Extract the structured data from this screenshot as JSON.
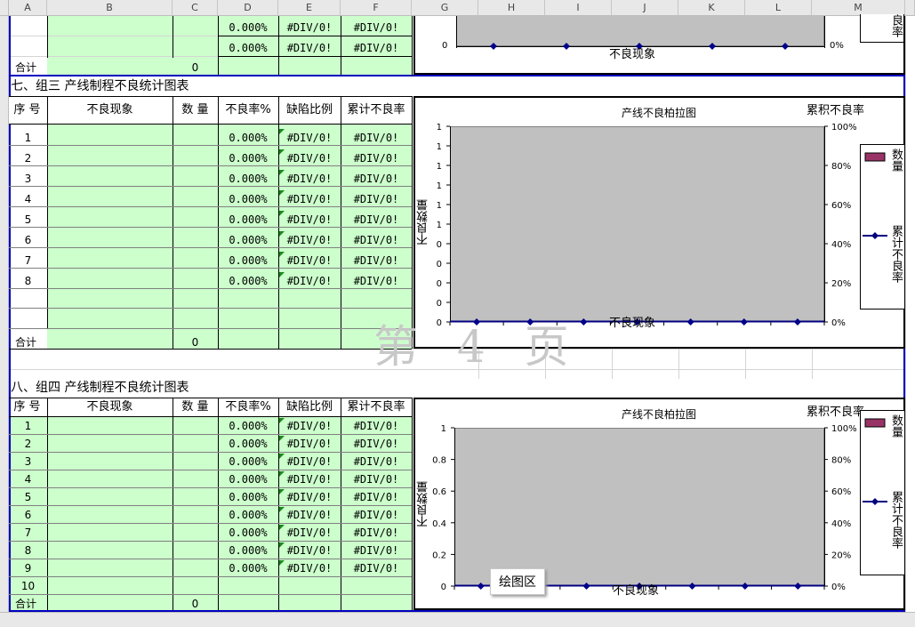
{
  "columns": [
    "A",
    "B",
    "C",
    "D",
    "E",
    "F",
    "G",
    "H",
    "I",
    "J",
    "K",
    "L",
    "M"
  ],
  "sec_top": {
    "rows": [
      {
        "rate": "0.000%",
        "defect": "#DIV/0!",
        "cum": "#DIV/0!"
      },
      {
        "rate": "0.000%",
        "defect": "#DIV/0!",
        "cum": "#DIV/0!"
      }
    ],
    "total_label": "合计",
    "total_value": "0",
    "chart": {
      "x_title": "不良现象",
      "right_tick": "0%",
      "left_tick": "0",
      "right_title": "良率"
    }
  },
  "sec7": {
    "title": "七、组三 产线制程不良统计图表",
    "headers": {
      "seq": "序 号",
      "phen": "不良现象",
      "qty": "数 量",
      "rate": "不良率%",
      "defect": "缺陷比例",
      "cum": "累计不良率"
    },
    "rows": [
      {
        "n": "1",
        "rate": "0.000%",
        "defect": "#DIV/0!",
        "cum": "#DIV/0!"
      },
      {
        "n": "2",
        "rate": "0.000%",
        "defect": "#DIV/0!",
        "cum": "#DIV/0!"
      },
      {
        "n": "3",
        "rate": "0.000%",
        "defect": "#DIV/0!",
        "cum": "#DIV/0!"
      },
      {
        "n": "4",
        "rate": "0.000%",
        "defect": "#DIV/0!",
        "cum": "#DIV/0!"
      },
      {
        "n": "5",
        "rate": "0.000%",
        "defect": "#DIV/0!",
        "cum": "#DIV/0!"
      },
      {
        "n": "6",
        "rate": "0.000%",
        "defect": "#DIV/0!",
        "cum": "#DIV/0!"
      },
      {
        "n": "7",
        "rate": "0.000%",
        "defect": "#DIV/0!",
        "cum": "#DIV/0!"
      },
      {
        "n": "8",
        "rate": "0.000%",
        "defect": "#DIV/0!",
        "cum": "#DIV/0!"
      }
    ],
    "total_label": "合计",
    "total_value": "0",
    "chart": {
      "title": "产线不良柏拉图",
      "right_title": "累积不良率",
      "y_title": "不良数量",
      "x_title": "不良现象",
      "left_ticks": [
        "1",
        "1",
        "1",
        "1",
        "1",
        "1",
        "0",
        "0",
        "0",
        "0",
        "0"
      ],
      "right_ticks": [
        "100%",
        "80%",
        "60%",
        "40%",
        "20%",
        "0%"
      ],
      "legend": [
        {
          "label": "数量",
          "color": "#993366"
        },
        {
          "label": "累计不良率",
          "color": "#000080"
        }
      ]
    }
  },
  "watermark": "第 4 页",
  "sec8": {
    "title": "八、组四 产线制程不良统计图表",
    "headers": {
      "seq": "序 号",
      "phen": "不良现象",
      "qty": "数 量",
      "rate": "不良率%",
      "defect": "缺陷比例",
      "cum": "累计不良率"
    },
    "rows": [
      {
        "n": "1",
        "rate": "0.000%",
        "defect": "#DIV/0!",
        "cum": "#DIV/0!"
      },
      {
        "n": "2",
        "rate": "0.000%",
        "defect": "#DIV/0!",
        "cum": "#DIV/0!"
      },
      {
        "n": "3",
        "rate": "0.000%",
        "defect": "#DIV/0!",
        "cum": "#DIV/0!"
      },
      {
        "n": "4",
        "rate": "0.000%",
        "defect": "#DIV/0!",
        "cum": "#DIV/0!"
      },
      {
        "n": "5",
        "rate": "0.000%",
        "defect": "#DIV/0!",
        "cum": "#DIV/0!"
      },
      {
        "n": "6",
        "rate": "0.000%",
        "defect": "#DIV/0!",
        "cum": "#DIV/0!"
      },
      {
        "n": "7",
        "rate": "0.000%",
        "defect": "#DIV/0!",
        "cum": "#DIV/0!"
      },
      {
        "n": "8",
        "rate": "0.000%",
        "defect": "#DIV/0!",
        "cum": "#DIV/0!"
      },
      {
        "n": "9",
        "rate": "0.000%",
        "defect": "#DIV/0!",
        "cum": "#DIV/0!"
      },
      {
        "n": "10",
        "rate": "",
        "defect": "",
        "cum": ""
      }
    ],
    "total_label": "合计",
    "total_value": "0",
    "chart": {
      "title": "产线不良柏拉图",
      "right_title": "累积不良率",
      "y_title": "不良数量",
      "x_title": "不良现象",
      "left_ticks": [
        "1",
        "0.8",
        "0.6",
        "0.4",
        "0.2",
        "0"
      ],
      "right_ticks": [
        "100%",
        "80%",
        "60%",
        "40%",
        "20%",
        "0%"
      ],
      "legend": [
        {
          "label": "数量",
          "color": "#993366"
        },
        {
          "label": "累计不良率",
          "color": "#000080"
        }
      ],
      "tooltip": "绘图区"
    }
  }
}
